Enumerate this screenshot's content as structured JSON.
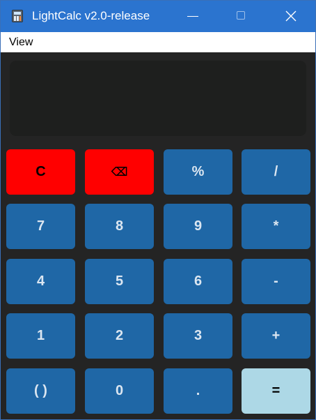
{
  "window": {
    "title": "LightCalc v2.0-release",
    "icon": "calculator-icon"
  },
  "menu": {
    "items": [
      "View"
    ]
  },
  "display": {
    "value": ""
  },
  "keys": {
    "clear": "C",
    "backspace": "⌫",
    "percent": "%",
    "divide": "/",
    "seven": "7",
    "eight": "8",
    "nine": "9",
    "multiply": "*",
    "four": "4",
    "five": "5",
    "six": "6",
    "subtract": "-",
    "one": "1",
    "two": "2",
    "three": "3",
    "add": "+",
    "parens": "( )",
    "zero": "0",
    "decimal": ".",
    "equals": "="
  },
  "colors": {
    "titlebar": "#2b74cf",
    "menubar": "#ffffff",
    "background": "#242424",
    "display": "#1e1f1e",
    "key_default": "#1f67a6",
    "key_danger": "#ff0000",
    "key_equals": "#add8e6"
  }
}
